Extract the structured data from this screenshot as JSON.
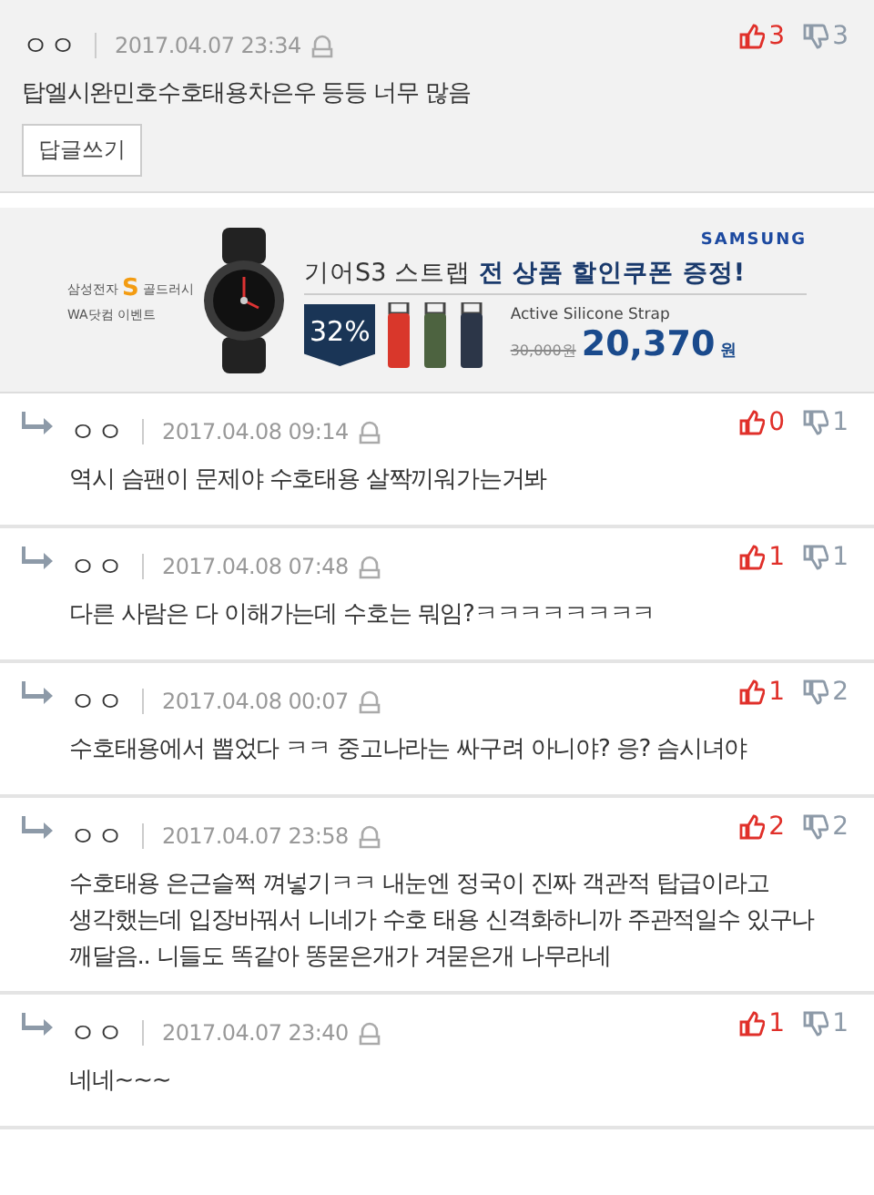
{
  "post": {
    "author": "ㅇㅇ",
    "date": "2017.04.07 23:34",
    "likes": "3",
    "dislikes": "3",
    "body": "탑엘시완민호수호태용차은우 등등 너무 많음",
    "reply_button": "답글쓰기"
  },
  "ad": {
    "brand_line": "삼성전자",
    "brand_mark": "S",
    "brand_sub": "골드러시",
    "event": "WA닷컴 이벤트",
    "maker": "SAMSUNG",
    "headline": "기어S3 스트랩 **전 상품 할인쿠폰 증정!**",
    "discount": "32%",
    "product": "Active Silicone Strap",
    "old_price": "30,000원",
    "price": "20,370",
    "currency": "원",
    "straps": [
      {
        "color": "#d9372b"
      },
      {
        "color": "#4d6340"
      },
      {
        "color": "#2c3648"
      }
    ]
  },
  "replies": [
    {
      "author": "ㅇㅇ",
      "date": "2017.04.08 09:14",
      "likes": "0",
      "dislikes": "1",
      "body": "역시 슴팬이 문제야 수호태용 살짝끼워가는거봐"
    },
    {
      "author": "ㅇㅇ",
      "date": "2017.04.08 07:48",
      "likes": "1",
      "dislikes": "1",
      "body": "다른 사람은 다 이해가는데 수호는 뭐임?ㅋㅋㅋㅋㅋㅋㅋㅋ"
    },
    {
      "author": "ㅇㅇ",
      "date": "2017.04.08 00:07",
      "likes": "1",
      "dislikes": "2",
      "body": "수호태용에서 뽑었다 ㅋㅋ 중고나라는 싸구려 아니야? 응? 슴시녀야"
    },
    {
      "author": "ㅇㅇ",
      "date": "2017.04.07 23:58",
      "likes": "2",
      "dislikes": "2",
      "body": "수호태용 은근슬쩍 껴넣기ㅋㅋ 내눈엔 정국이 진짜 객관적 탑급이라고 생각했는데 입장바꿔서 니네가 수호 태용 신격화하니까 주관적일수 있구나 깨달음.. 니들도 똑같아 똥묻은개가 겨묻은개 나무라네"
    },
    {
      "author": "ㅇㅇ",
      "date": "2017.04.07 23:40",
      "likes": "1",
      "dislikes": "1",
      "body": "네네~~~"
    }
  ]
}
